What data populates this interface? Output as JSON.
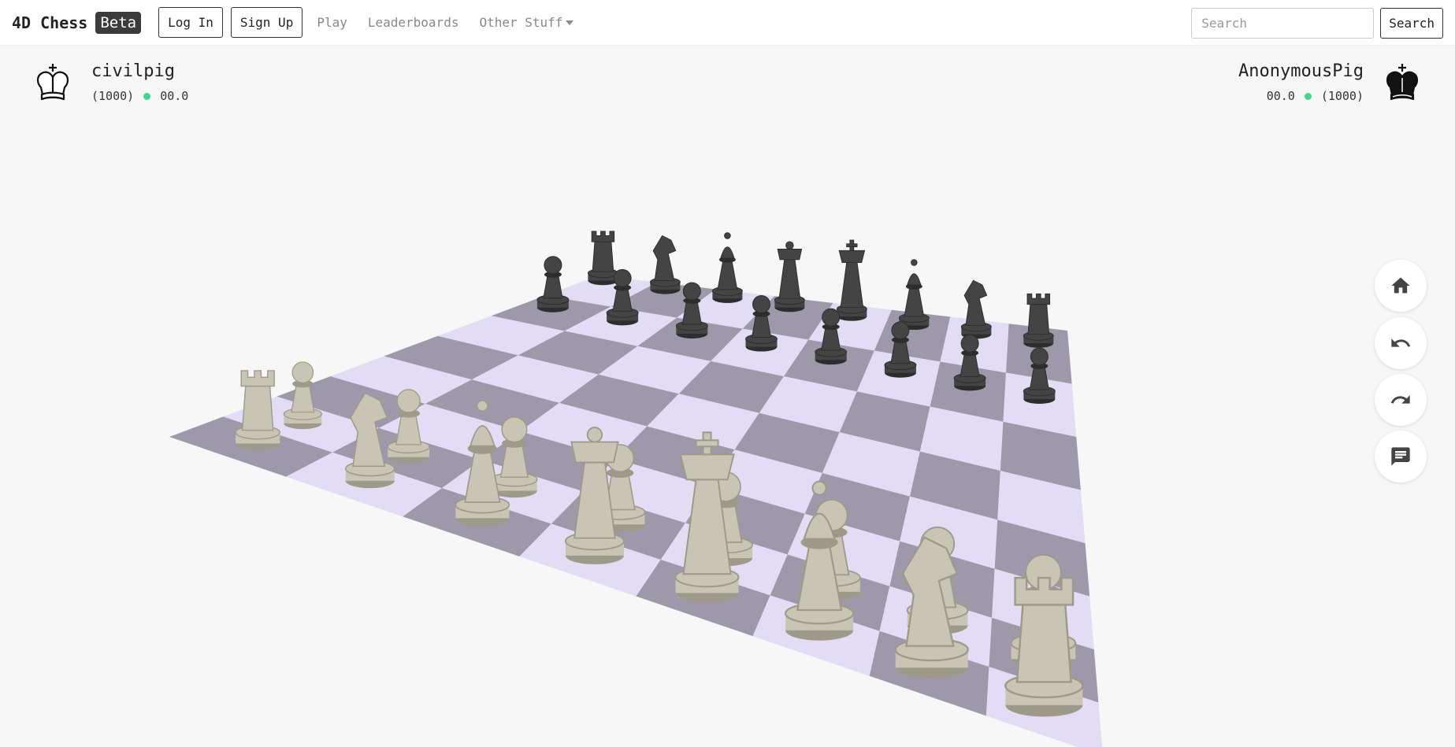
{
  "nav": {
    "brand": "4D Chess",
    "badge": "Beta",
    "login": "Log In",
    "signup": "Sign Up",
    "play": "Play",
    "leaderboards": "Leaderboards",
    "other": "Other Stuff",
    "search_placeholder": "Search",
    "search_button": "Search"
  },
  "players": {
    "white": {
      "name": "civilpig",
      "rating": "(1000)",
      "time": "00.0",
      "icon": "white-king-icon"
    },
    "black": {
      "name": "AnonymousPig",
      "rating": "(1000)",
      "time": "00.0",
      "icon": "black-king-icon"
    }
  },
  "controls": [
    {
      "name": "home-button",
      "icon": "home-icon"
    },
    {
      "name": "undo-button",
      "icon": "undo-icon"
    },
    {
      "name": "redo-button",
      "icon": "redo-icon"
    },
    {
      "name": "chat-button",
      "icon": "chat-icon"
    }
  ],
  "colors": {
    "light_square": "#e2ddf4",
    "dark_square": "#9e98ab",
    "white_piece": "#c9c5b4",
    "black_piece": "#444444",
    "status_dot": "#3ddc84"
  }
}
